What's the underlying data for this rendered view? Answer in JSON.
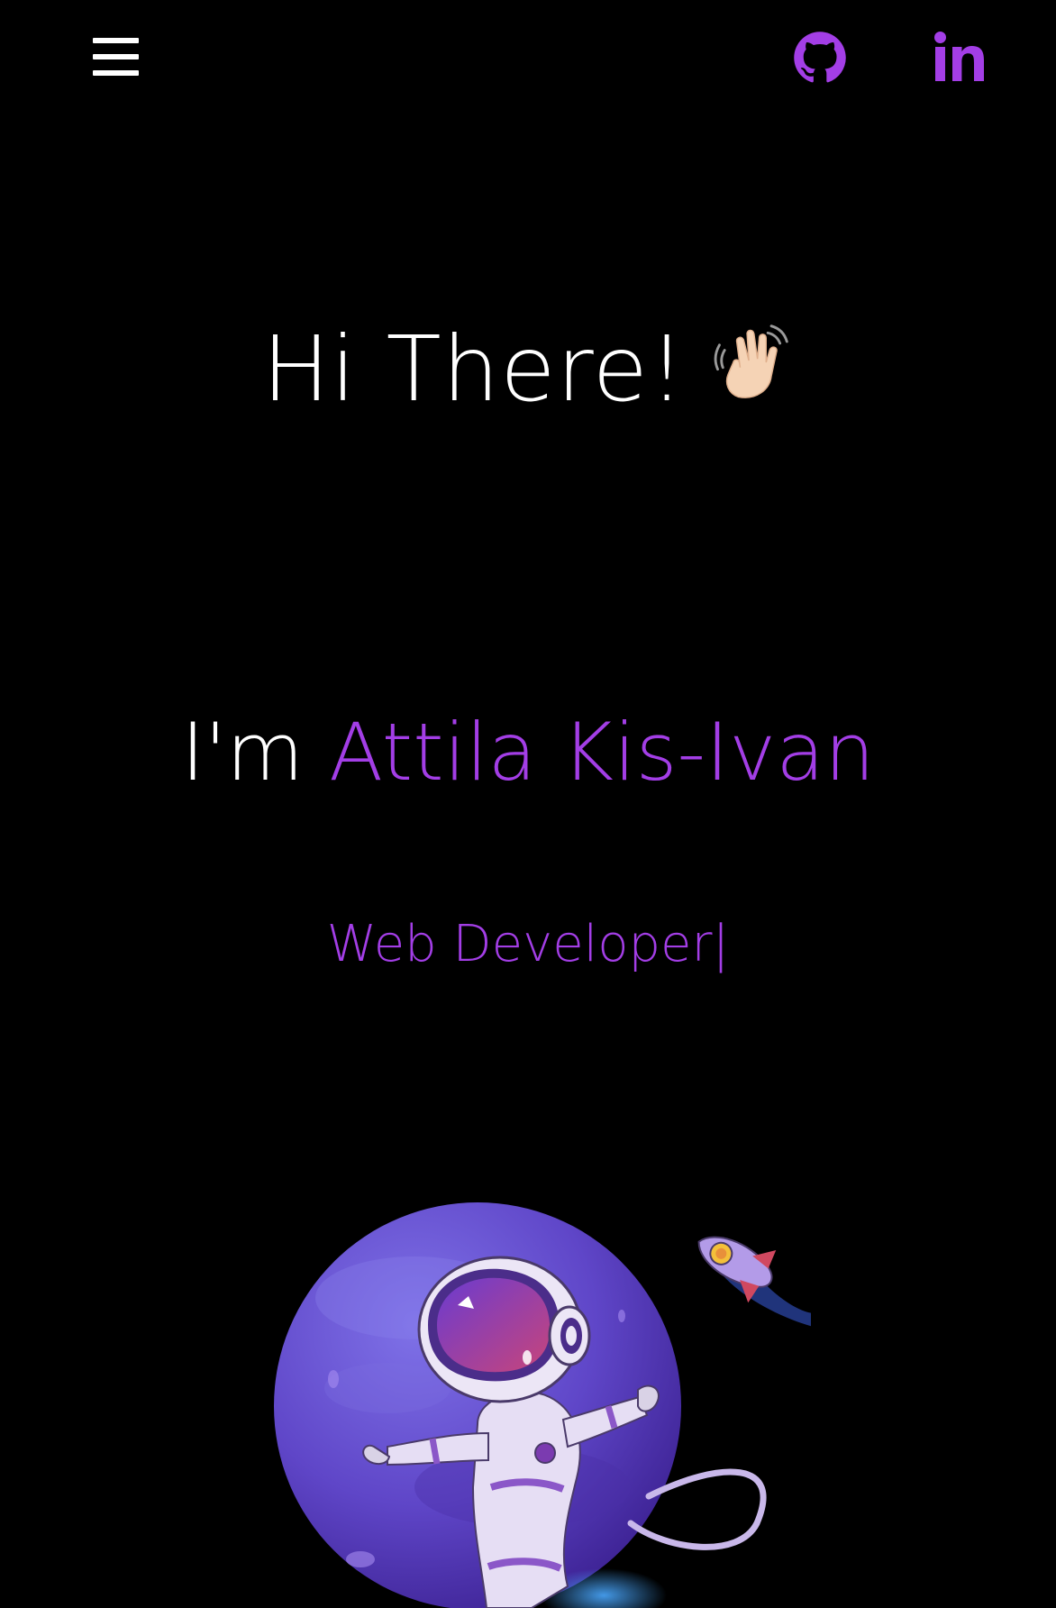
{
  "header": {
    "menu_icon": "hamburger-menu-icon",
    "social_links": [
      {
        "name": "github",
        "icon": "github-icon"
      },
      {
        "name": "linkedin",
        "icon": "linkedin-icon"
      }
    ]
  },
  "hero": {
    "greeting": "Hi There!",
    "wave_emoji": "👋🏻",
    "intro_prefix": "I'm",
    "name": "Attila Kis-Ivan",
    "role": "Web Developer",
    "cursor": "|"
  },
  "illustration": {
    "subject": "astronaut-planet-rocket-illustration"
  },
  "colors": {
    "background": "#000000",
    "accent": "#a33ee6",
    "text": "#ffffff",
    "planet": "#6a4fd0"
  }
}
